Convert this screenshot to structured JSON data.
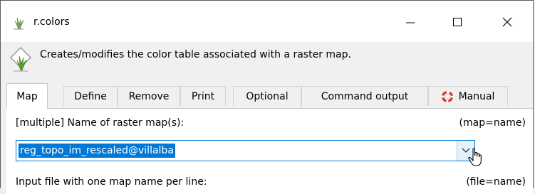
{
  "window": {
    "title": "r.colors"
  },
  "description": "Creates/modifies the color table associated with a raster map.",
  "tabs": [
    {
      "label": "Map"
    },
    {
      "label": "Define"
    },
    {
      "label": "Remove"
    },
    {
      "label": "Print"
    },
    {
      "label": "Optional"
    },
    {
      "label": "Command output"
    },
    {
      "label": "Manual"
    }
  ],
  "map_section": {
    "label": "[multiple] Name of raster map(s):",
    "param": "(map=name)",
    "value": "reg_topo_im_rescaled@villalba"
  },
  "file_section": {
    "label": "Input file with one map name per line:",
    "param": "(file=name)"
  },
  "icons": [
    "grass-icon",
    "minimize-icon",
    "maximize-icon",
    "close-icon",
    "lifebuoy-icon",
    "chevron-down-icon",
    "mouse-cursor-icon"
  ]
}
